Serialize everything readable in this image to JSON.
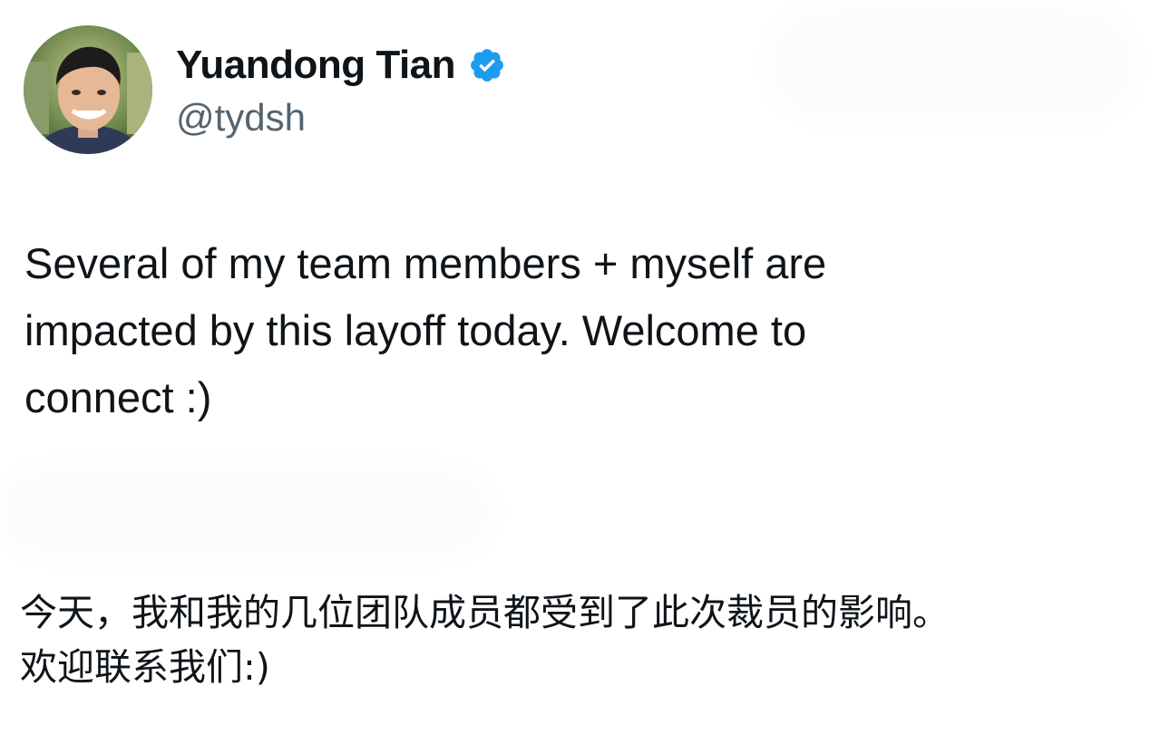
{
  "tweet": {
    "author": {
      "display_name": "Yuandong Tian",
      "handle": "@tydsh",
      "verified": true,
      "avatar_icon": "profile-photo"
    },
    "text_en": "Several of my team members + myself are\nimpacted by this layoff today. Welcome to\nconnect :)",
    "text_zh": "今天，我和我的几位团队成员都受到了此次裁员的影响。\n欢迎联系我们:)"
  },
  "colors": {
    "text_primary": "#0f1419",
    "text_secondary": "#536471",
    "verified_badge": "#1d9bf0"
  }
}
